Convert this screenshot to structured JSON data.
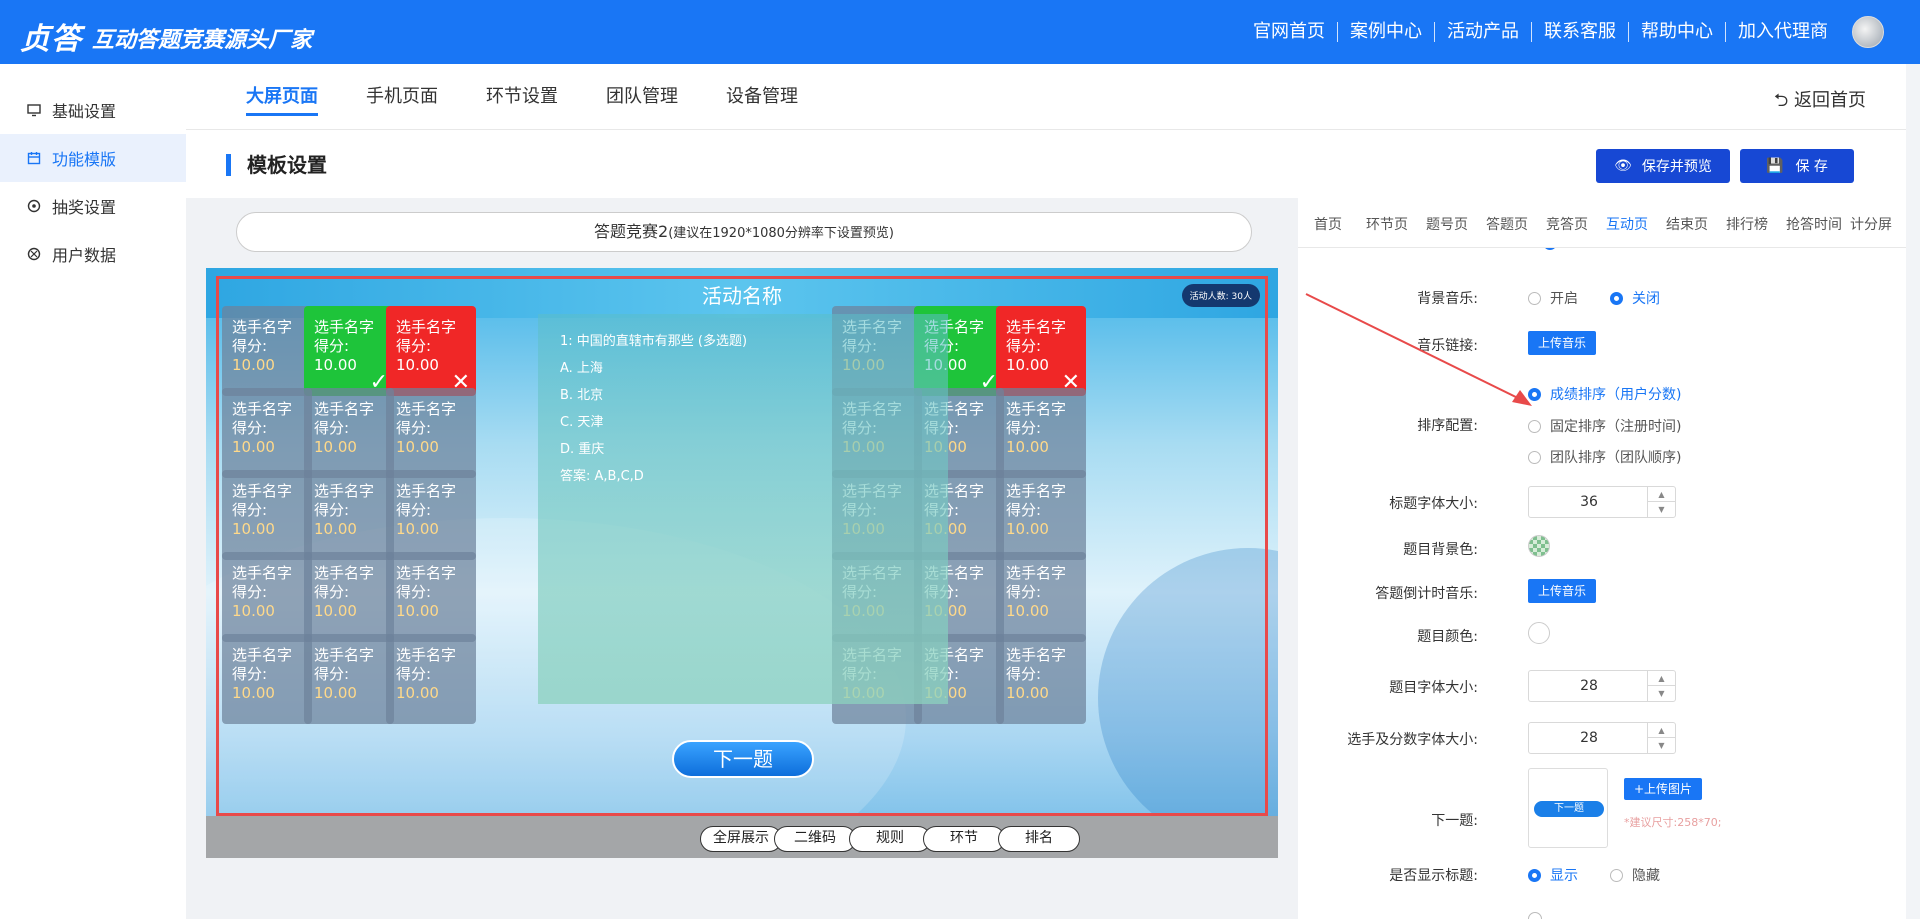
{
  "brand": {
    "logo": "贞答",
    "slogan": "互动答题竞赛源头厂家"
  },
  "topnav": [
    "官网首页",
    "案例中心",
    "活动产品",
    "联系客服",
    "帮助中心",
    "加入代理商"
  ],
  "sidebar": {
    "items": [
      {
        "label": "基础设置",
        "icon": "monitor-icon"
      },
      {
        "label": "功能模版",
        "icon": "calendar-icon",
        "active": true
      },
      {
        "label": "抽奖设置",
        "icon": "gear-icon"
      },
      {
        "label": "用户数据",
        "icon": "aperture-icon"
      }
    ]
  },
  "tabs": [
    "大屏页面",
    "手机页面",
    "环节设置",
    "团队管理",
    "设备管理"
  ],
  "back_label": "返回首页",
  "section_title": "模板设置",
  "buttons": {
    "save_preview": "保存并预览",
    "save": "保 存"
  },
  "preview": {
    "url_main": "答题竞赛2",
    "url_hint": "(建议在1920*1080分辨率下设置预览)",
    "activity_title": "活动名称",
    "people": "活动人数: 30人",
    "player_name": "选手名字",
    "score_label": "得分:",
    "score": "10.00",
    "question": {
      "lines": [
        "1: 中国的直辖市有那些  (多选题)",
        "A. 上海",
        "B. 北京",
        "C. 天津",
        "D. 重庆",
        "答案: A,B,C,D"
      ]
    },
    "next": "下一题",
    "bottom_buttons": [
      "全屏展示",
      "二维码",
      "规则",
      "环节",
      "排名"
    ]
  },
  "right_tabs": [
    "首页",
    "环节页",
    "题号页",
    "答题页",
    "竞答页",
    "互动页",
    "结束页",
    "排行榜",
    "抢答时间",
    "计分屏"
  ],
  "right_tabs_active": "互动页",
  "form": {
    "bg_music": {
      "label": "背景音乐:",
      "options": [
        "开启",
        "关闭"
      ],
      "selected": "关闭"
    },
    "music_link": {
      "label": "音乐链接:",
      "button": "上传音乐"
    },
    "sort": {
      "label": "排序配置:",
      "options": [
        "成绩排序（用户分数)",
        "固定排序（注册时间)",
        "团队排序（团队顺序)"
      ],
      "selected": "成绩排序（用户分数)"
    },
    "title_font": {
      "label": "标题字体大小:",
      "value": "36"
    },
    "q_bg_color": {
      "label": "题目背景色:"
    },
    "countdown_music": {
      "label": "答题倒计时音乐:",
      "button": "上传音乐"
    },
    "q_color": {
      "label": "题目颜色:"
    },
    "q_font": {
      "label": "题目字体大小:",
      "value": "28"
    },
    "player_font": {
      "label": "选手及分数字体大小:",
      "value": "28"
    },
    "next": {
      "label": "下一题:",
      "thumb_text": "下一题",
      "upload": "+上传图片",
      "hint": "*建议尺寸:258*70;"
    },
    "show_title": {
      "label": "是否显示标题:",
      "options": [
        "显示",
        "隐藏"
      ],
      "selected": "显示"
    }
  },
  "colors": {
    "brand_blue": "#1976f5",
    "dark_blue_button": "#1748d4",
    "correct": "#1ec43a",
    "wrong": "#f02727",
    "highlight_frame": "#e84a4a"
  }
}
